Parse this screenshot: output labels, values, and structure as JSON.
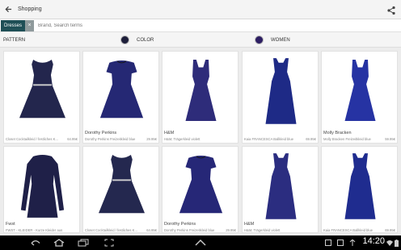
{
  "app": {
    "title": "Shopping"
  },
  "search": {
    "chip_label": "Dresses",
    "chip_remove": "×",
    "placeholder": "Brand, Search terms"
  },
  "filters": [
    {
      "label": "PATTERN"
    },
    {
      "label": "COLOR",
      "swatch_color": "#1d1e3a"
    },
    {
      "label": "WOMEN",
      "swatch_color": "#2d1e63"
    }
  ],
  "products": [
    {
      "brand": "",
      "name": "Closet Cocktailkleid / festliches K...",
      "price": "64.95€",
      "dress_color": "#23264d",
      "style": "sleeveless"
    },
    {
      "brand": "Dorothy Perkins",
      "name": "Dorothy Perkins Freizeitkleid blue",
      "price": "29.95€",
      "dress_color": "#252874",
      "style": "cap"
    },
    {
      "brand": "H&M",
      "name": "H&M, Trägerkleid violett",
      "price": "",
      "dress_color": "#2e2c7a",
      "style": "strap"
    },
    {
      "brand": "",
      "name": "Kaia FRANCESCA Ballkleid blue",
      "price": "69.95€",
      "dress_color": "#1e2a86",
      "style": "gown"
    },
    {
      "brand": "Molly Bracken",
      "name": "Molly Bracken Freizeitkleid blue",
      "price": "59.95€",
      "dress_color": "#2633a3",
      "style": "strap"
    },
    {
      "brand": "Fwst",
      "name": "FWST - KLEIDER - Kurze Kleider aus der...",
      "price": "",
      "dress_color": "#1f2048",
      "style": "longsleeve"
    },
    {
      "brand": "",
      "name": "Closet Cocktailkleid / festliches K...",
      "price": "64.95€",
      "dress_color": "#24284f",
      "style": "sleeveless"
    },
    {
      "brand": "Dorothy Perkins",
      "name": "Dorothy Perkins Freizeitkleid blue",
      "price": "29.95€",
      "dress_color": "#262777",
      "style": "cap"
    },
    {
      "brand": "H&M",
      "name": "H&M, Trägerkleid violett",
      "price": "",
      "dress_color": "#2b2d80",
      "style": "gown"
    },
    {
      "brand": "",
      "name": "Kaia FRANCESCA Ballkleid blue",
      "price": "69.95€",
      "dress_color": "#1f2c8f",
      "style": "gown"
    }
  ],
  "status": {
    "time": "14:20"
  },
  "icons": {
    "back": "arrow-back-icon",
    "share": "share-icon",
    "nav_back": "nav-back-icon",
    "nav_home": "nav-home-icon",
    "nav_recent": "nav-recent-apps-icon",
    "nav_screenshot": "screenshot-icon",
    "nav_up": "chevron-up-icon",
    "wifi": "wifi-icon",
    "battery": "battery-icon"
  }
}
